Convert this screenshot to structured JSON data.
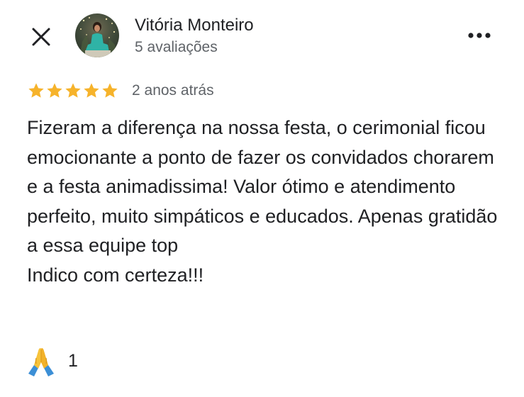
{
  "header": {
    "close_icon": "close-icon",
    "more_icon": "more-horizontal-icon",
    "reviewer": {
      "name": "Vitória Monteiro",
      "review_count": "5 avaliações",
      "avatar_icon": "profile-photo"
    }
  },
  "review": {
    "rating": 5,
    "rating_max": 5,
    "star_color": "#F6B32B",
    "date": "2 anos atrás",
    "text": "Fizeram a diferença na nossa festa, o cerimonial ficou emocionante a ponto de fazer os convidados chorarem e a festa animadissima! Valor ótimo e atendimento perfeito, muito simpáticos e educados. Apenas gratidão a essa equipe top\nIndico com certeza!!!"
  },
  "reactions": {
    "icon": "folded-hands-emoji",
    "count": "1"
  }
}
